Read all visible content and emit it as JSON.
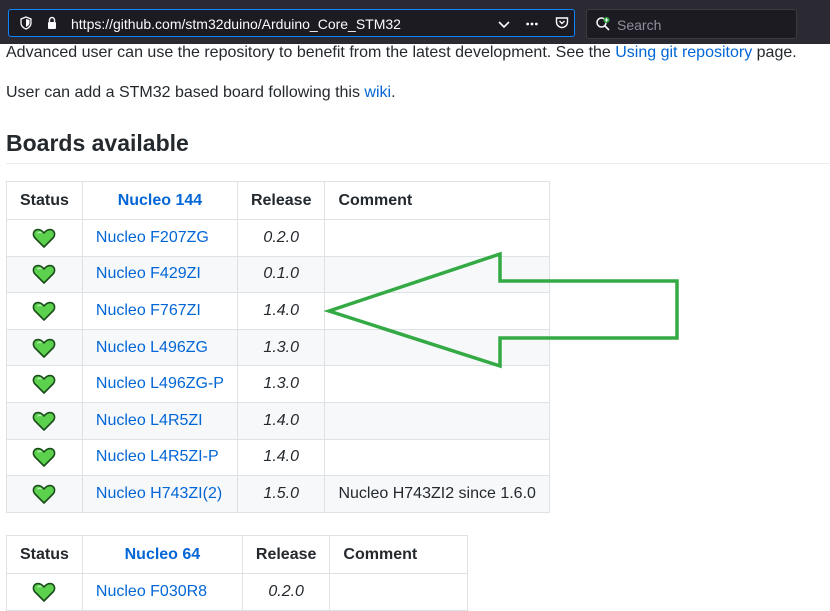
{
  "browser": {
    "url": "https://github.com/stm32duino/Arduino_Core_STM32",
    "search_placeholder": "Search",
    "icons": [
      "shield-icon",
      "lock-icon",
      "chevron-down-icon",
      "more-icon",
      "pocket-icon",
      "search-icon"
    ]
  },
  "intro": {
    "line1_before": "Advanced user can use the repository to benefit from the latest development. See the ",
    "line1_link": "Using git repository",
    "line1_after": " page.",
    "line2_before": "User can add a STM32 based board following this ",
    "line2_link": "wiki",
    "line2_after": "."
  },
  "section_title": "Boards available",
  "table1": {
    "headers": [
      "Status",
      "Nucleo 144",
      "Release",
      "Comment"
    ],
    "rows": [
      {
        "board": "Nucleo F207ZG",
        "release": "0.2.0",
        "comment": ""
      },
      {
        "board": "Nucleo F429ZI",
        "release": "0.1.0",
        "comment": ""
      },
      {
        "board": "Nucleo F767ZI",
        "release": "1.4.0",
        "comment": ""
      },
      {
        "board": "Nucleo L496ZG",
        "release": "1.3.0",
        "comment": ""
      },
      {
        "board": "Nucleo L496ZG-P",
        "release": "1.3.0",
        "comment": ""
      },
      {
        "board": "Nucleo L4R5ZI",
        "release": "1.4.0",
        "comment": ""
      },
      {
        "board": "Nucleo L4R5ZI-P",
        "release": "1.4.0",
        "comment": ""
      },
      {
        "board": "Nucleo H743ZI(2)",
        "release": "1.5.0",
        "comment": "Nucleo H743ZI2 since 1.6.0"
      }
    ]
  },
  "table2": {
    "headers": [
      "Status",
      "Nucleo 64",
      "Release",
      "Comment"
    ],
    "rows": [
      {
        "board": "Nucleo F030R8",
        "release": "0.2.0",
        "comment": ""
      }
    ]
  },
  "colors": {
    "link": "#0366d6",
    "heart_fill": "#5cd14d",
    "arrow_stroke": "#33aa44"
  }
}
